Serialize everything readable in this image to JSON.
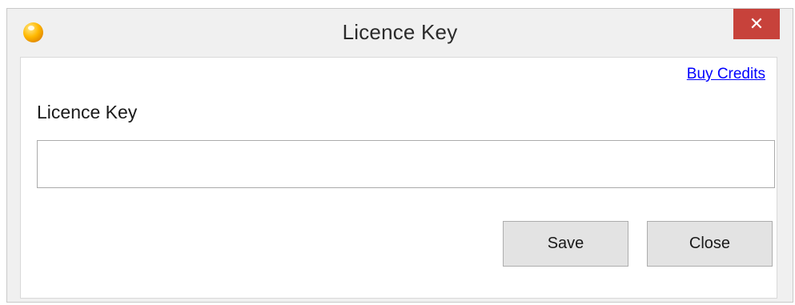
{
  "window": {
    "title": "Licence Key",
    "app_icon": "orange-orb-icon",
    "close_glyph": "✕",
    "close_color": "#c7423b"
  },
  "form": {
    "buy_credits_link": "Buy Credits",
    "licence_key_label": "Licence Key",
    "licence_key_value": "",
    "licence_key_placeholder": ""
  },
  "buttons": {
    "save_label": "Save",
    "close_label": "Close"
  }
}
